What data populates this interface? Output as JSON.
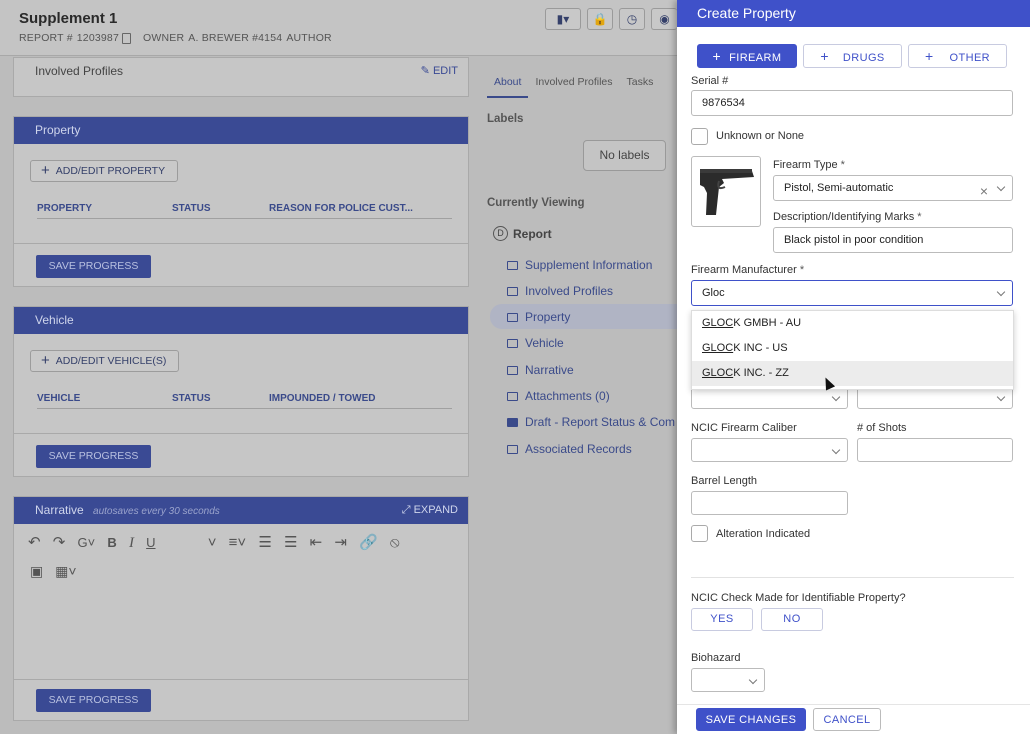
{
  "report": {
    "title": "Supplement 1",
    "report_label": "REPORT #",
    "report_no": "1203987",
    "owner_label": "OWNER",
    "owner": "A. BREWER #4154",
    "author_label": "AUTHOR"
  },
  "involved": {
    "title": "Involved Profiles",
    "edit": "EDIT"
  },
  "property": {
    "title": "Property",
    "add": "ADD/EDIT PROPERTY",
    "cols": [
      "PROPERTY",
      "STATUS",
      "REASON FOR POLICE CUST..."
    ],
    "save": "SAVE PROGRESS"
  },
  "vehicle": {
    "title": "Vehicle",
    "add": "ADD/EDIT VEHICLE(S)",
    "cols": [
      "VEHICLE",
      "STATUS",
      "IMPOUNDED / TOWED"
    ],
    "save": "SAVE PROGRESS"
  },
  "narrative": {
    "title": "Narrative",
    "note": "autosaves every 30 seconds",
    "expand": "EXPAND",
    "save": "SAVE PROGRESS"
  },
  "tabs": [
    "About",
    "Involved Profiles",
    "Tasks"
  ],
  "labels": {
    "title": "Labels",
    "none": "No labels"
  },
  "viewing": {
    "title": "Currently Viewing",
    "badge": "D",
    "report": "Report",
    "items": [
      "Supplement Information",
      "Involved Profiles",
      "Property",
      "Vehicle",
      "Narrative",
      "Attachments (0)",
      "Draft - Report Status & Com",
      "Associated Records"
    ]
  },
  "panel": {
    "title": "Create Property",
    "types": [
      "FIREARM",
      "DRUGS",
      "OTHER"
    ],
    "serial_label": "Serial #",
    "serial": "9876534",
    "unknown": "Unknown or None",
    "ftype_label": "Firearm Type",
    "ftype": "Pistol, Semi-automatic",
    "desc_label": "Description/Identifying Marks",
    "desc": "Black pistol in poor condition",
    "mfr_label": "Firearm Manufacturer",
    "mfr": "Gloc",
    "options": [
      {
        "match": "GLOC",
        "rest": "K GMBH - AU"
      },
      {
        "match": "GLOC",
        "rest": "K INC - US"
      },
      {
        "match": "GLOC",
        "rest": "K INC. - ZZ"
      }
    ],
    "caliber_label": "NCIC Firearm Caliber",
    "shots_label": "# of Shots",
    "barrel_label": "Barrel Length",
    "alteration": "Alteration Indicated",
    "ncic_label": "NCIC Check Made for Identifiable Property?",
    "yes": "YES",
    "no": "NO",
    "bio_label": "Biohazard",
    "save": "SAVE CHANGES",
    "cancel": "CANCEL"
  }
}
